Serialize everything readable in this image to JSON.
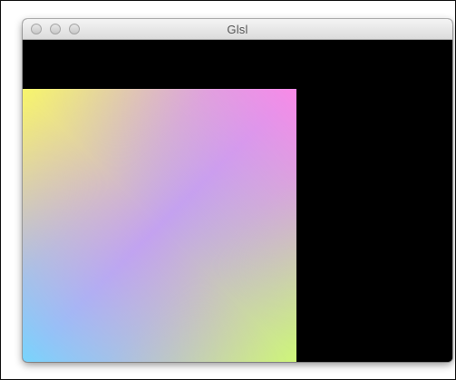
{
  "window": {
    "title": "Glsl"
  },
  "canvas": {
    "background": "#000000",
    "quad_corner_colors": {
      "top_left": "#f7f56c",
      "top_right": "#f98ae6",
      "bottom_left": "#77d5fb",
      "bottom_right": "#cef57a",
      "center": "#c4a2f0"
    }
  }
}
